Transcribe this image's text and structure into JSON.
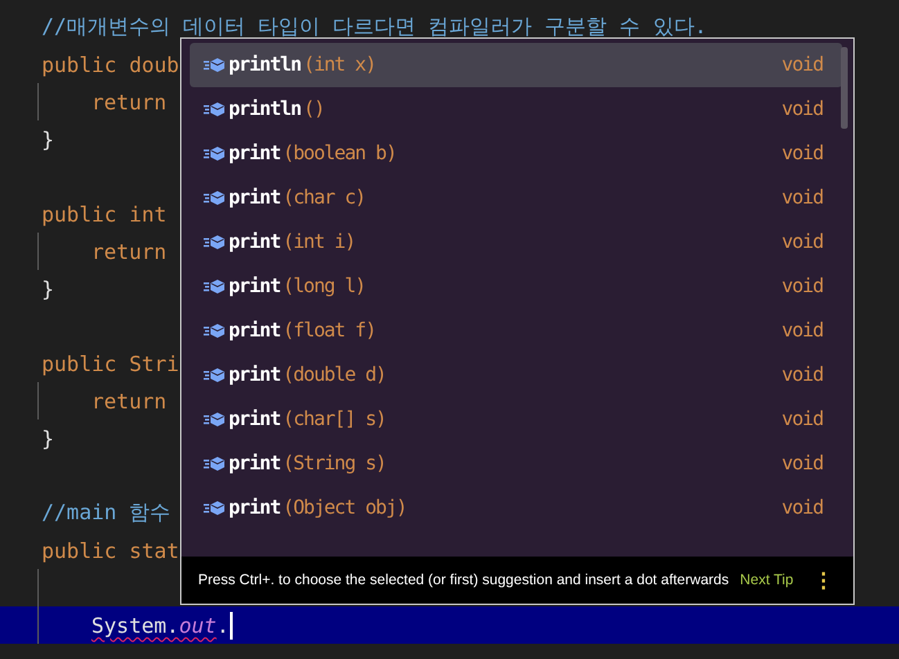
{
  "editor": {
    "lines": [
      {
        "kind": "code",
        "segments": [
          {
            "kind": "comment",
            "text": "//매개변수의 데이터 타입이 다르다면 컴파일러가 구분할 수 있다."
          }
        ]
      },
      {
        "kind": "code",
        "segments": [
          {
            "kind": "keyword",
            "text": "public doub"
          }
        ]
      },
      {
        "kind": "indented",
        "segments": [
          {
            "kind": "keyword",
            "text": "return"
          }
        ]
      },
      {
        "kind": "code",
        "segments": [
          {
            "kind": "plain",
            "text": "}"
          }
        ]
      },
      {
        "kind": "blank"
      },
      {
        "kind": "code",
        "segments": [
          {
            "kind": "keyword",
            "text": "public int"
          }
        ]
      },
      {
        "kind": "indented",
        "segments": [
          {
            "kind": "keyword",
            "text": "return"
          }
        ]
      },
      {
        "kind": "code",
        "segments": [
          {
            "kind": "plain",
            "text": "}"
          }
        ]
      },
      {
        "kind": "blank"
      },
      {
        "kind": "code",
        "segments": [
          {
            "kind": "keyword",
            "text": "public Stri"
          }
        ]
      },
      {
        "kind": "indented",
        "segments": [
          {
            "kind": "keyword",
            "text": "return"
          }
        ]
      },
      {
        "kind": "code",
        "segments": [
          {
            "kind": "plain",
            "text": "}"
          }
        ]
      },
      {
        "kind": "blank"
      },
      {
        "kind": "code",
        "segments": [
          {
            "kind": "comment",
            "text": "//main 함수"
          }
        ]
      },
      {
        "kind": "code",
        "segments": [
          {
            "kind": "keyword",
            "text": "public stat"
          }
        ]
      },
      {
        "kind": "indented-blank"
      },
      {
        "kind": "current",
        "segments": [
          {
            "kind": "plain",
            "text": "System.",
            "squiggle": true
          },
          {
            "kind": "field",
            "text": "out",
            "squiggle": true
          },
          {
            "kind": "plain",
            "text": ".",
            "squiggle": false
          }
        ]
      }
    ]
  },
  "suggestions": {
    "items": [
      {
        "name": "println",
        "params": "(int x)",
        "type": "void",
        "selected": true
      },
      {
        "name": "println",
        "params": "()",
        "type": "void",
        "selected": false
      },
      {
        "name": "print",
        "params": "(boolean b)",
        "type": "void",
        "selected": false
      },
      {
        "name": "print",
        "params": "(char c)",
        "type": "void",
        "selected": false
      },
      {
        "name": "print",
        "params": "(int i)",
        "type": "void",
        "selected": false
      },
      {
        "name": "print",
        "params": "(long l)",
        "type": "void",
        "selected": false
      },
      {
        "name": "print",
        "params": "(float f)",
        "type": "void",
        "selected": false
      },
      {
        "name": "print",
        "params": "(double d)",
        "type": "void",
        "selected": false
      },
      {
        "name": "print",
        "params": "(char[] s)",
        "type": "void",
        "selected": false
      },
      {
        "name": "print",
        "params": "(String s)",
        "type": "void",
        "selected": false
      },
      {
        "name": "print",
        "params": "(Object obj)",
        "type": "void",
        "selected": false
      }
    ],
    "footer": {
      "tip": "Press Ctrl+. to choose the selected (or first) suggestion and insert a dot afterwards",
      "link": "Next Tip",
      "menu": "⋮"
    }
  }
}
